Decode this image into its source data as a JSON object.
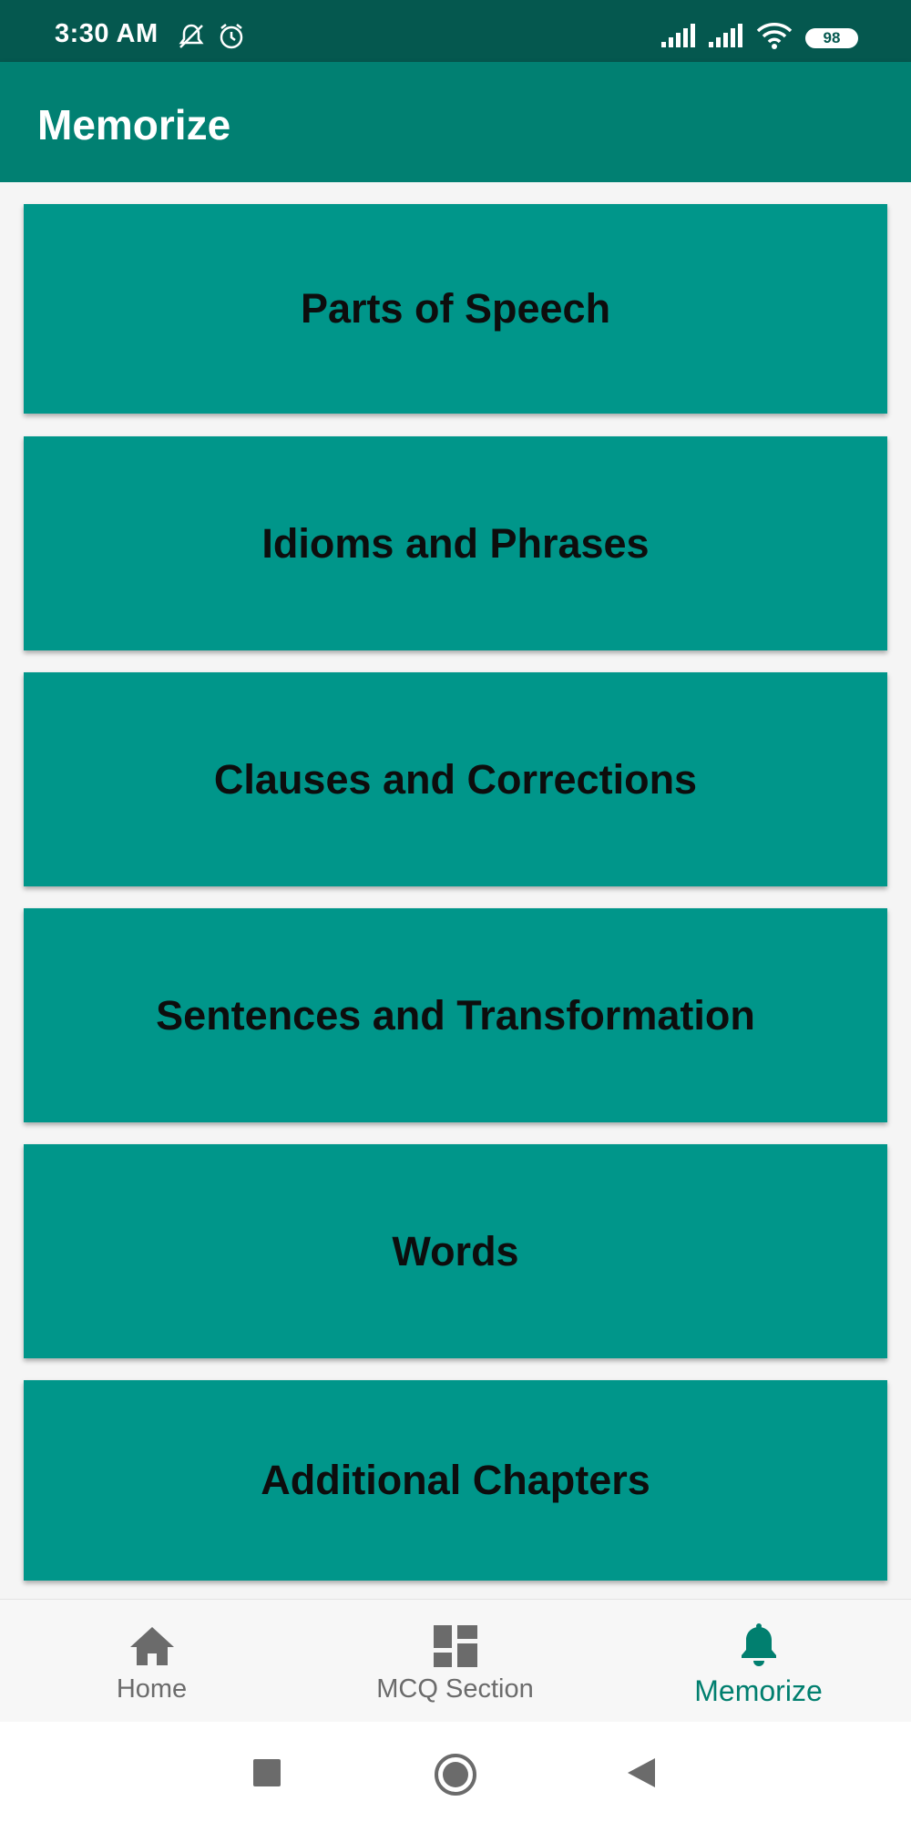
{
  "status_bar": {
    "time": "3:30 AM",
    "icons": [
      "muted-bell-icon",
      "alarm-icon",
      "signal-icon",
      "signal-icon",
      "wifi-icon",
      "battery-icon"
    ],
    "battery_level": "98"
  },
  "app_bar": {
    "title": "Memorize"
  },
  "cards": [
    {
      "label": "Parts of Speech"
    },
    {
      "label": "Idioms and Phrases"
    },
    {
      "label": "Clauses and Corrections"
    },
    {
      "label": "Sentences and Transformation"
    },
    {
      "label": "Words"
    },
    {
      "label": "Additional Chapters"
    }
  ],
  "bottom_nav": {
    "items": [
      {
        "label": "Home",
        "icon": "home-icon",
        "active": false
      },
      {
        "label": "MCQ Section",
        "icon": "dashboard-icon",
        "active": false
      },
      {
        "label": "Memorize",
        "icon": "bell-icon",
        "active": true
      }
    ]
  },
  "system_nav": {
    "icons": [
      "recents-square-icon",
      "home-circle-icon",
      "back-triangle-icon"
    ]
  },
  "colors": {
    "status_bar": "#05584f",
    "app_bar": "#018072",
    "card": "#00968a",
    "active_nav": "#017f6f",
    "inactive_nav": "#6b6b6b"
  }
}
